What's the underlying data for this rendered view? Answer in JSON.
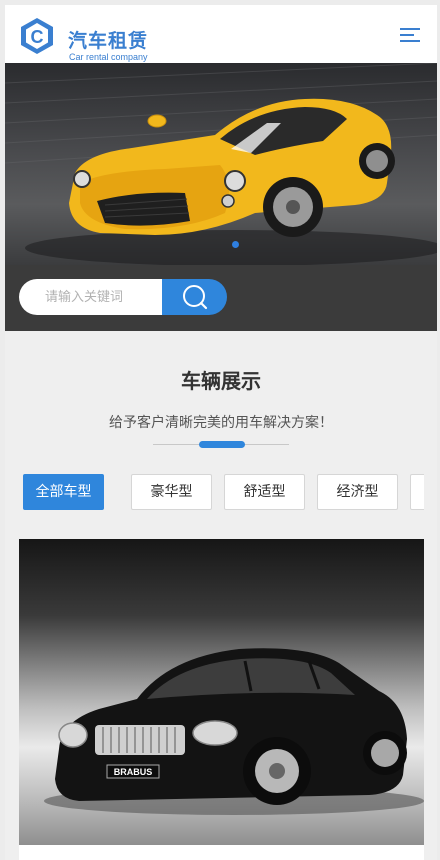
{
  "header": {
    "logo_title": "汽车租赁",
    "logo_subtitle": "Car rental company",
    "logo_letter": "C",
    "menu_icon": "hamburger-menu-icon"
  },
  "banner": {
    "slide_count": 1,
    "active_slide": 1
  },
  "search": {
    "placeholder": "请输入关键词",
    "value": "",
    "button_icon": "search-icon"
  },
  "section": {
    "title": "车辆展示",
    "subtitle": "给予客户清晰完美的用车解决方案！"
  },
  "tabs": [
    {
      "label": "全部车型",
      "active": true
    },
    {
      "label": "豪华型",
      "active": false
    },
    {
      "label": "舒适型",
      "active": false
    },
    {
      "label": "经济型",
      "active": false
    }
  ],
  "car": {
    "plate": "BRABUS"
  },
  "colors": {
    "brand_blue": "#2f86dc",
    "search_bg": "#3b3b3b",
    "car_yellow": "#f2b81c"
  }
}
